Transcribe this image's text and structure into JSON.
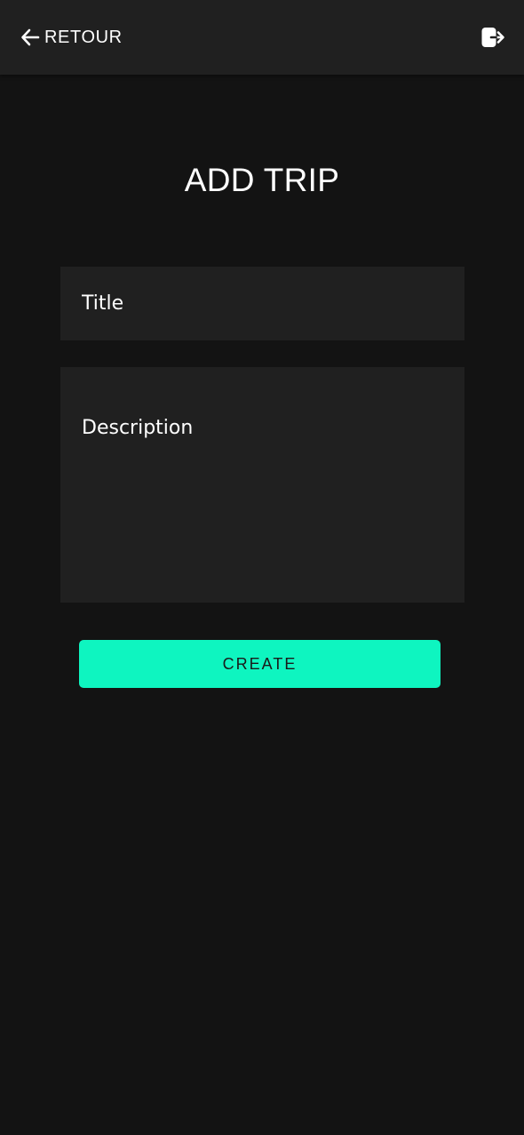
{
  "header": {
    "back_label": "RETOUR",
    "back_icon": "arrow-left-icon",
    "logout_icon": "logout-icon"
  },
  "main": {
    "title": "ADD TRIP",
    "form": {
      "title_field": {
        "placeholder": "Title",
        "value": ""
      },
      "description_field": {
        "placeholder": "Description",
        "value": ""
      },
      "create_label": "CREATE"
    }
  },
  "colors": {
    "background": "#131313",
    "header": "#202020",
    "field": "#202020",
    "accent": "#0ef5c0",
    "text": "#ffffff"
  }
}
